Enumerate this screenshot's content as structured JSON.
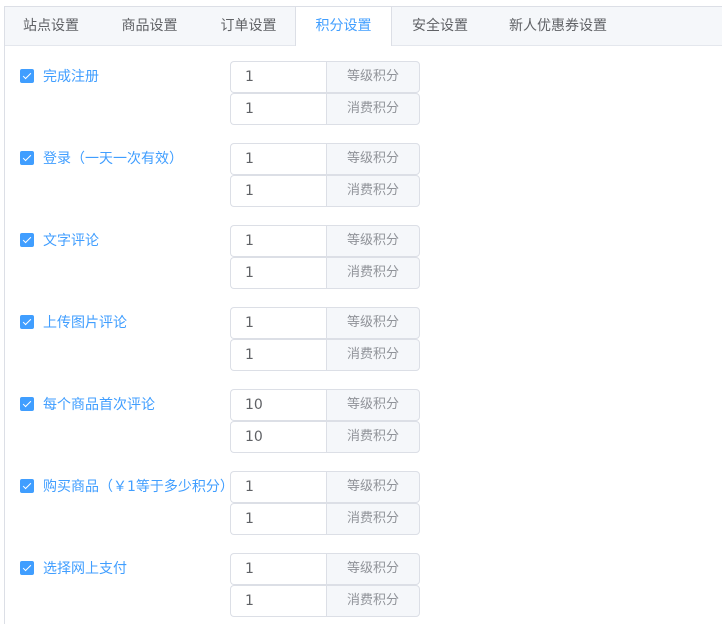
{
  "tabs": [
    {
      "label": "站点设置",
      "active": false
    },
    {
      "label": "商品设置",
      "active": false
    },
    {
      "label": "订单设置",
      "active": false
    },
    {
      "label": "积分设置",
      "active": true
    },
    {
      "label": "安全设置",
      "active": false
    },
    {
      "label": "新人优惠券设置",
      "active": false
    }
  ],
  "rows": [
    {
      "label": "完成注册",
      "checked": true,
      "level_points": "1",
      "consume_points": "1",
      "level_suffix": "等级积分",
      "consume_suffix": "消费积分"
    },
    {
      "label": "登录（一天一次有效）",
      "checked": true,
      "level_points": "1",
      "consume_points": "1",
      "level_suffix": "等级积分",
      "consume_suffix": "消费积分"
    },
    {
      "label": "文字评论",
      "checked": true,
      "level_points": "1",
      "consume_points": "1",
      "level_suffix": "等级积分",
      "consume_suffix": "消费积分"
    },
    {
      "label": "上传图片评论",
      "checked": true,
      "level_points": "1",
      "consume_points": "1",
      "level_suffix": "等级积分",
      "consume_suffix": "消费积分"
    },
    {
      "label": "每个商品首次评论",
      "checked": true,
      "level_points": "10",
      "consume_points": "10",
      "level_suffix": "等级积分",
      "consume_suffix": "消费积分"
    },
    {
      "label": "购买商品（￥1等于多少积分）",
      "checked": true,
      "level_points": "1",
      "consume_points": "1",
      "level_suffix": "等级积分",
      "consume_suffix": "消费积分"
    },
    {
      "label": "选择网上支付",
      "checked": true,
      "level_points": "1",
      "consume_points": "1",
      "level_suffix": "等级积分",
      "consume_suffix": "消费积分"
    }
  ],
  "colors": {
    "accent": "#409eff",
    "tab_bar": "#f5f7fa",
    "border": "#dcdfe6"
  }
}
